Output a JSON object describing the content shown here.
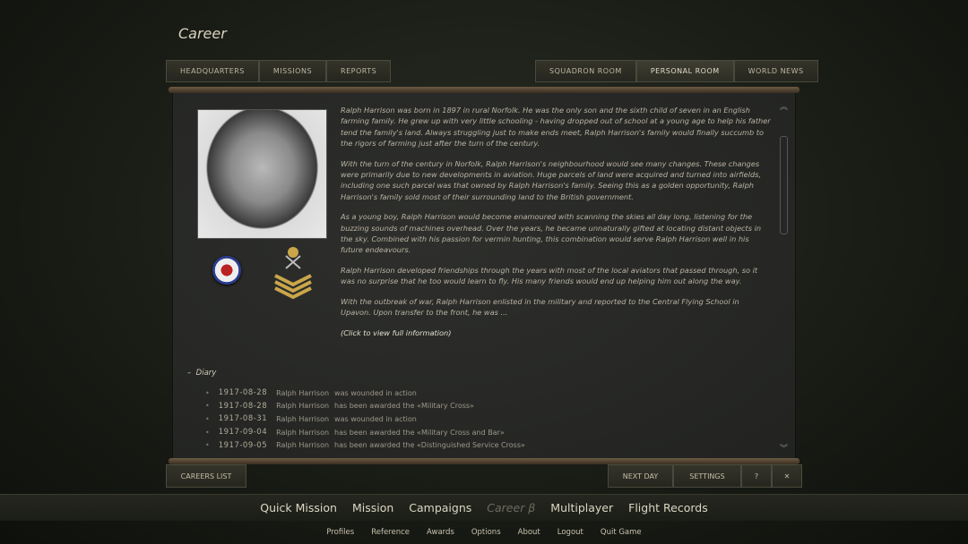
{
  "title": "Career",
  "tabs_left": [
    "HEADQUARTERS",
    "MISSIONS",
    "REPORTS"
  ],
  "tabs_right": [
    "SQUADRON ROOM",
    "PERSONAL ROOM",
    "WORLD NEWS"
  ],
  "active_tab": "PERSONAL ROOM",
  "bio": [
    "Ralph Harrison was born in 1897 in rural Norfolk. He was the only son and the sixth child of seven in an English farming family. He grew up with very little schooling - having dropped out of school at a young age to help his father tend the family's land. Always struggling just to make ends meet, Ralph Harrison's family would finally succumb to the rigors of farming just after the turn of the century.",
    "With the turn of the century in Norfolk, Ralph Harrison's neighbourhood would see many changes. These changes were primarily due to new developments in aviation. Huge parcels of land were acquired and turned into airfields, including one such parcel was that owned by Ralph Harrison's family. Seeing this as a golden opportunity, Ralph Harrison's family sold most of their surrounding land to the British government.",
    "As a young boy, Ralph Harrison would become enamoured with scanning the skies all day long, listening for the buzzing sounds of machines overhead. Over the years, he became unnaturally gifted at locating distant objects in the sky. Combined with his passion for vermin hunting, this combination would serve Ralph Harrison well in his future endeavours.",
    "Ralph Harrison developed friendships through the years with most of the local aviators that passed through, so it was no surprise that he too would learn to fly. His many friends would end up helping him out along the way.",
    "With the outbreak of war, Ralph Harrison enlisted in the military and reported to the Central Flying School in Upavon. Upon transfer to the front, he was ..."
  ],
  "bio_link": "(Click to view full information)",
  "diary_title": "Diary",
  "diary_toggle": "–",
  "diary": [
    {
      "date": "1917-08-28",
      "name": "Ralph Harrison",
      "text": "was wounded in action"
    },
    {
      "date": "1917-08-28",
      "name": "Ralph Harrison",
      "text": "has been awarded the «Military Cross»"
    },
    {
      "date": "1917-08-31",
      "name": "Ralph Harrison",
      "text": "was wounded in action"
    },
    {
      "date": "1917-09-04",
      "name": "Ralph Harrison",
      "text": "has been awarded the «Military Cross and Bar»"
    },
    {
      "date": "1917-09-05",
      "name": "Ralph Harrison",
      "text": "has been awarded the «Distinguished Service Cross»"
    }
  ],
  "bottom": {
    "careers_list": "CAREERS LIST",
    "next_day": "NEXT DAY",
    "settings": "SETTINGS",
    "help_icon": "?",
    "close_icon": "✕"
  },
  "nav": [
    "Quick Mission",
    "Mission",
    "Campaigns",
    "Career β",
    "Multiplayer",
    "Flight Records"
  ],
  "nav_active": "Career β",
  "footer": [
    "Profiles",
    "Reference",
    "Awards",
    "Options",
    "About",
    "Logout",
    "Quit Game"
  ]
}
